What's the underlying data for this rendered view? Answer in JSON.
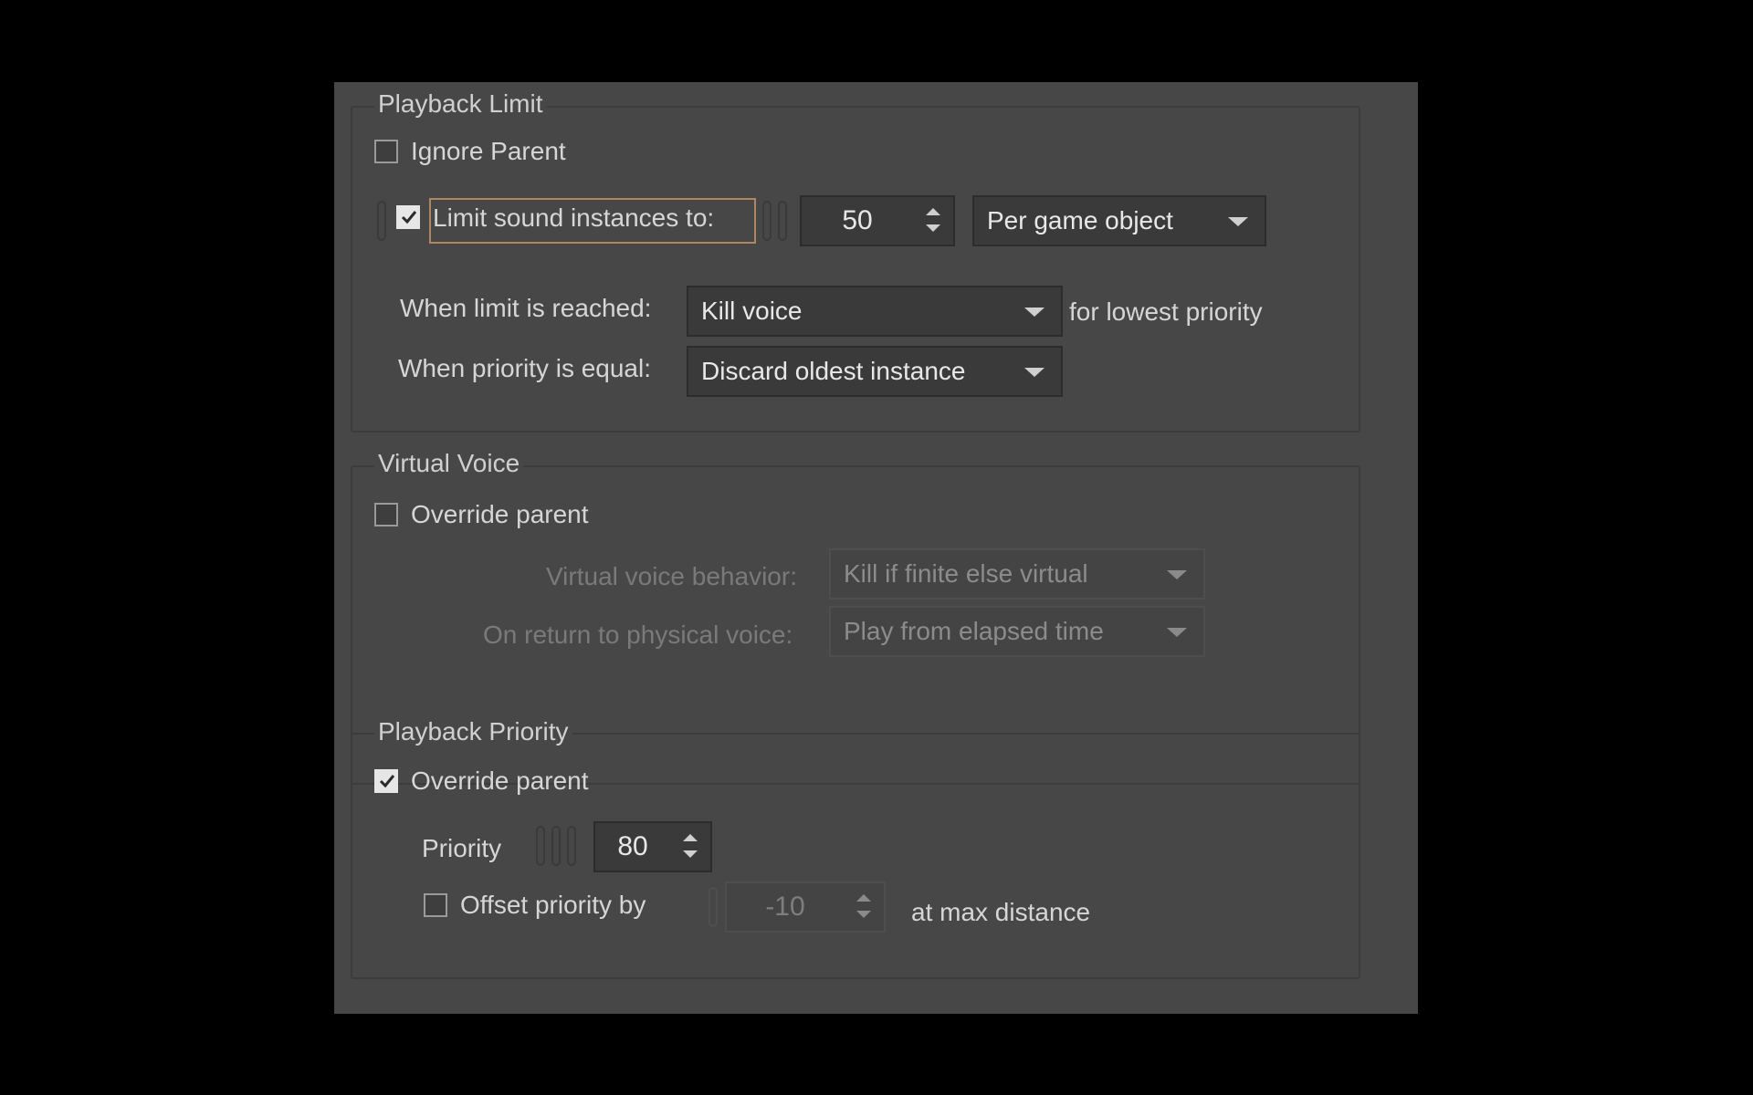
{
  "playback_limit": {
    "title": "Playback Limit",
    "ignore_parent_label": "Ignore Parent",
    "ignore_parent_checked": false,
    "limit_instances_label": "Limit sound instances to:",
    "limit_instances_checked": true,
    "limit_value": "50",
    "scope_dropdown": "Per game object",
    "when_limit_label": "When limit is reached:",
    "when_limit_dropdown": "Kill voice",
    "for_lowest_priority_label": "for lowest priority",
    "when_priority_equal_label": "When priority is equal:",
    "when_priority_equal_dropdown": "Discard oldest instance"
  },
  "virtual_voice": {
    "title": "Virtual Voice",
    "override_parent_label": "Override parent",
    "override_parent_checked": false,
    "behavior_label": "Virtual voice behavior:",
    "behavior_dropdown": "Kill if finite else virtual",
    "return_label": "On return to physical voice:",
    "return_dropdown": "Play from elapsed time"
  },
  "playback_priority": {
    "title": "Playback Priority",
    "override_parent_label": "Override parent",
    "override_parent_checked": true,
    "priority_label": "Priority",
    "priority_value": "80",
    "offset_label": "Offset priority by",
    "offset_checked": false,
    "offset_value": "-10",
    "at_max_distance_label": "at max distance"
  },
  "colors": {
    "panel_bg": "#474747",
    "outer_bg": "#000000",
    "focus_frame": "#b08860",
    "text": "#d6d6d6",
    "disabled_text": "#7a7a7a"
  }
}
